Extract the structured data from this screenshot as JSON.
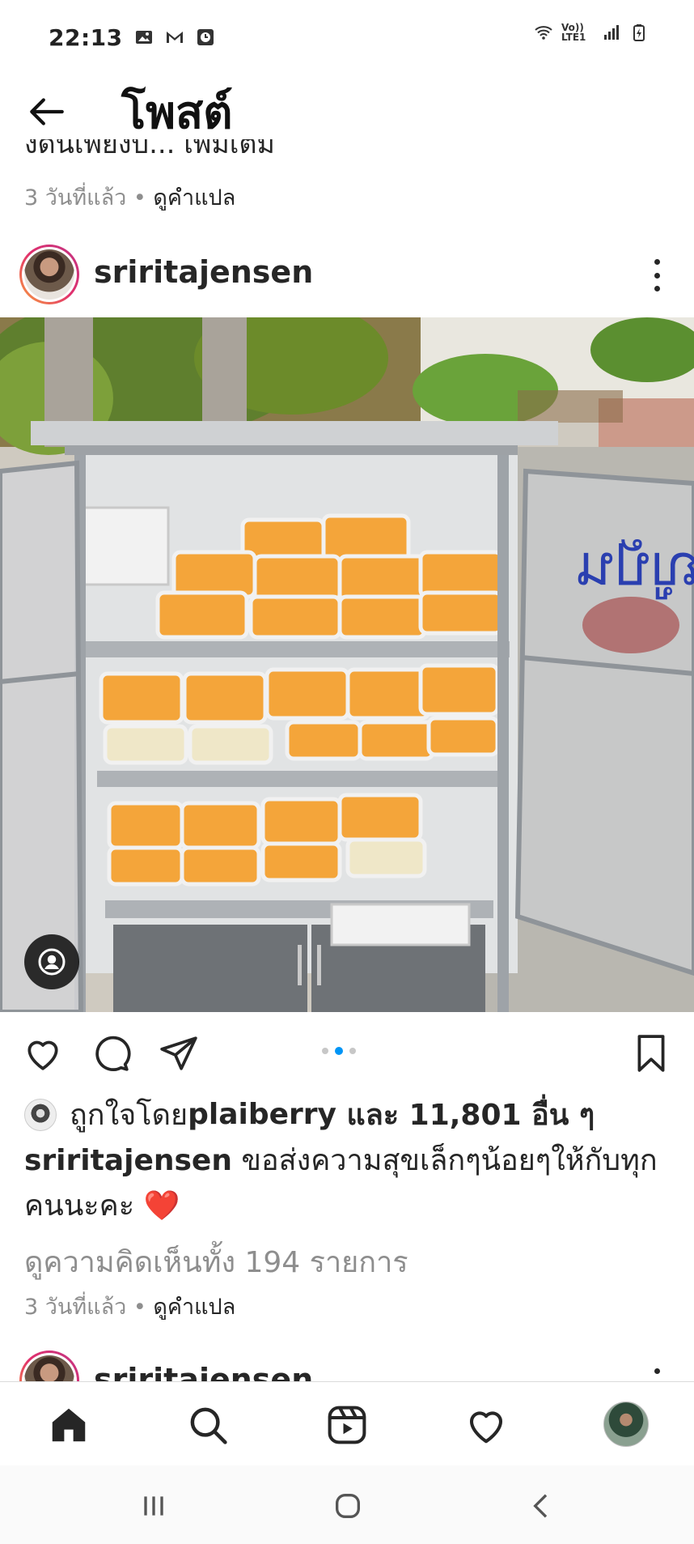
{
  "status_bar": {
    "time": "22:13",
    "left_icons": [
      "image-icon",
      "mail-icon",
      "clock-icon"
    ],
    "network_label": "Vo)) LTE1",
    "right_icons": [
      "wifi-icon",
      "signal-icon",
      "battery-icon"
    ]
  },
  "top_bar": {
    "title": "โพสต์",
    "back_icon": "arrow-left-icon"
  },
  "previous_post": {
    "caption_cut": "งดีนี่เพียงบ... เพิ่มเติม",
    "time_ago": "3 วันที่แล้ว",
    "separator": " • ",
    "translate": "ดูคำแปล"
  },
  "post": {
    "username": "sriritajensen",
    "photo_alt": "ตู้ใส่ข้าวเหนียวมะม่วง",
    "actions": [
      "heart-icon",
      "comment-icon",
      "share-icon",
      "bookmark-icon"
    ],
    "carousel": {
      "count": 3,
      "active_index": 1
    },
    "likes_prefix": "ถูกใจโดย ",
    "likes_user": "plaiberry",
    "likes_suffix": " และ 11,801 อื่น ๆ",
    "caption_username": "sriritajensen",
    "caption_text": " ขอส่งความสุขเล็กๆน้อยๆให้กับทุกคนนะคะ ",
    "caption_emoji": "❤️",
    "comments_link": "ดูความคิดเห็นทั้ง 194 รายการ",
    "time_ago": "3 วันที่แล้ว",
    "separator": " • ",
    "translate": "ดูคำแปล"
  },
  "next_post": {
    "username": "sriritajensen"
  },
  "bottom_nav": {
    "items": [
      "home-icon",
      "search-icon",
      "reels-icon",
      "activity-heart-icon",
      "profile-avatar"
    ]
  },
  "system_nav": {
    "items": [
      "recents-icon",
      "home-circle-icon",
      "back-chevron-icon"
    ]
  },
  "colors": {
    "text": "#262626",
    "muted": "#8e8e8e",
    "accent_blue": "#0095f6",
    "heart_red": "#ed4956"
  }
}
